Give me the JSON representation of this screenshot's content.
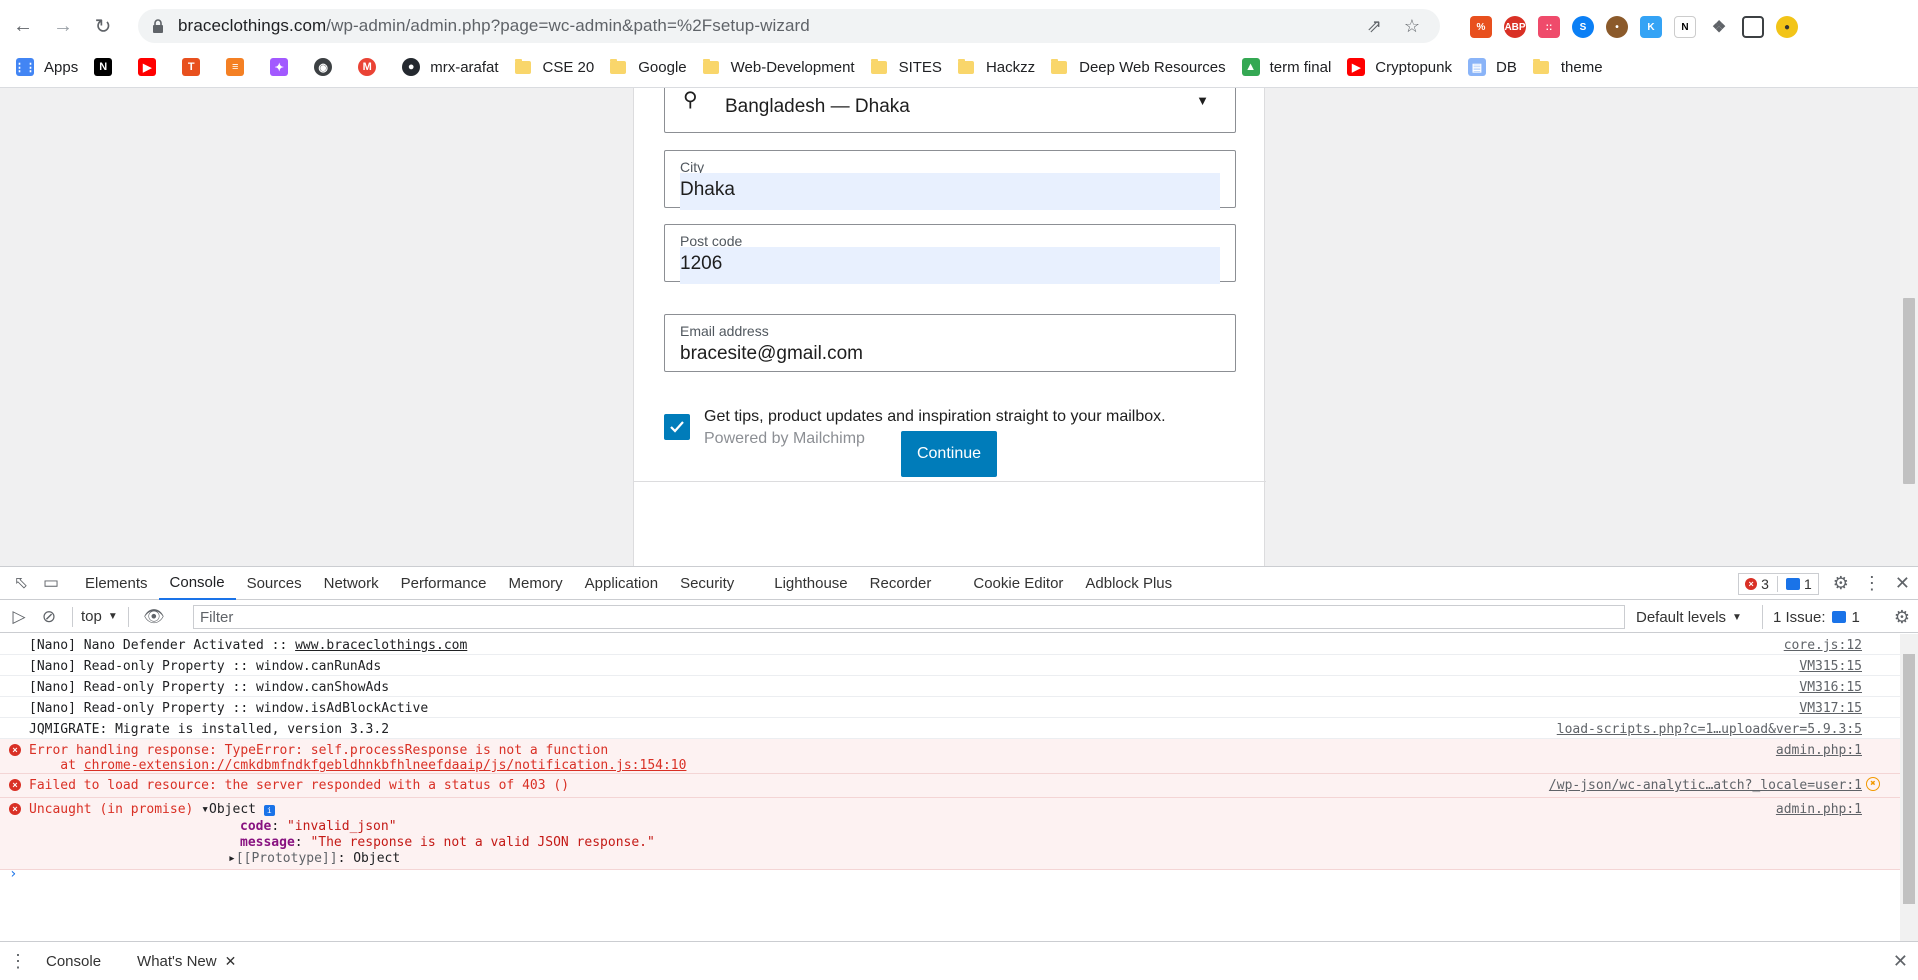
{
  "browser": {
    "url_host": "braceclothings.com",
    "url_path": "/wp-admin/admin.php?page=wc-admin&path=%2Fsetup-wizard"
  },
  "bookmarks": [
    {
      "label": "Apps",
      "icon": "apps-grid-icon"
    },
    {
      "label": "",
      "icon": "notion-icon"
    },
    {
      "label": "",
      "icon": "youtube-icon"
    },
    {
      "label": "",
      "icon": "t-icon"
    },
    {
      "label": "",
      "icon": "stack-icon"
    },
    {
      "label": "",
      "icon": "figma-icon"
    },
    {
      "label": "",
      "icon": "globe-icon"
    },
    {
      "label": "",
      "icon": "gmail-icon"
    },
    {
      "label": "mrx-arafat",
      "icon": "github-icon"
    },
    {
      "label": "CSE 20",
      "icon": "folder-icon"
    },
    {
      "label": "Google",
      "icon": "folder-icon"
    },
    {
      "label": "Web-Development",
      "icon": "folder-icon"
    },
    {
      "label": "SITES",
      "icon": "folder-icon"
    },
    {
      "label": "Hackzz",
      "icon": "folder-icon"
    },
    {
      "label": "Deep Web Resources",
      "icon": "folder-icon"
    },
    {
      "label": "term final",
      "icon": "drive-icon"
    },
    {
      "label": "Cryptopunk",
      "icon": "youtube-icon"
    },
    {
      "label": "DB",
      "icon": "page-icon"
    },
    {
      "label": "theme",
      "icon": "folder-icon"
    }
  ],
  "form": {
    "country_value": "Bangladesh — Dhaka",
    "city_label": "City",
    "city_value": "Dhaka",
    "postcode_label": "Post code",
    "postcode_value": "1206",
    "email_label": "Email address",
    "email_value": "bracesite@gmail.com",
    "newsletter_text": "Get tips, product updates and inspiration straight to your mailbox.",
    "newsletter_sub": "Powered by Mailchimp",
    "newsletter_checked": true,
    "continue_label": "Continue"
  },
  "devtools": {
    "tabs": [
      "Elements",
      "Console",
      "Sources",
      "Network",
      "Performance",
      "Memory",
      "Application",
      "Security",
      "Lighthouse",
      "Recorder",
      "Cookie Editor",
      "Adblock Plus"
    ],
    "active_tab": "Console",
    "error_count": "3",
    "message_count": "1",
    "context": "top",
    "filter_placeholder": "Filter",
    "levels": "Default levels",
    "issues_label": "1 Issue:",
    "issues_count": "1",
    "drawer_tabs": [
      "Console",
      "What's New"
    ],
    "colors": {
      "error": "#d93025",
      "accent": "#1a73e8"
    }
  },
  "console": [
    {
      "type": "log",
      "text": "[Nano] Nano Defender Activated :: ",
      "link": "www.braceclothings.com",
      "source": "core.js:12"
    },
    {
      "type": "log",
      "text": "[Nano] Read-only Property :: window.canRunAds",
      "source": "VM315:15"
    },
    {
      "type": "log",
      "text": "[Nano] Read-only Property :: window.canShowAds",
      "source": "VM316:15"
    },
    {
      "type": "log",
      "text": "[Nano] Read-only Property :: window.isAdBlockActive",
      "source": "VM317:15"
    },
    {
      "type": "log",
      "text": "JQMIGRATE: Migrate is installed, version 3.3.2",
      "source": "load-scripts.php?c=1…upload&ver=5.9.3:5"
    },
    {
      "type": "error",
      "text": "Error handling response: TypeError: self.processResponse is not a function",
      "text2": "    at ",
      "link": "chrome-extension://cmkdbmfndkfgebldhnkbfhlneefdaaip/js/notification.js:154:10",
      "source": "admin.php:1"
    },
    {
      "type": "error",
      "text": "Failed to load resource: the server responded with a status of 403 ()",
      "source": "/wp-json/wc-analytic…atch?_locale=user:1"
    },
    {
      "type": "error",
      "text": "Uncaught (in promise) ",
      "object_label": "Object",
      "obj_code_key": "code",
      "obj_code_val": "\"invalid_json\"",
      "obj_msg_key": "message",
      "obj_msg_val": "\"The response is not a valid JSON response.\"",
      "obj_proto": "[[Prototype]]",
      "obj_proto_val": "Object",
      "source": "admin.php:1"
    }
  ]
}
